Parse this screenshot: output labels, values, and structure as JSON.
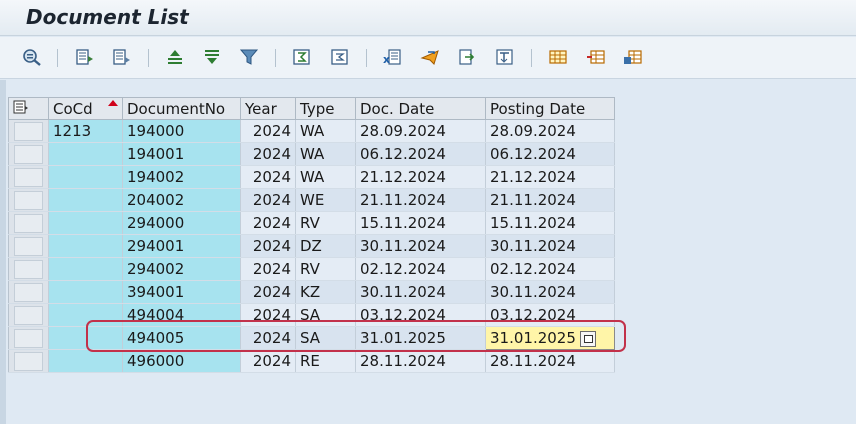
{
  "window": {
    "title": "Document List"
  },
  "toolbar": {
    "icons": [
      "details-icon",
      "choose-layout-icon",
      "select-layout-icon",
      "sort-ascending-icon",
      "sort-descending-icon",
      "filter-icon",
      "total-icon",
      "subtotal-icon",
      "export-spreadsheet-icon",
      "send-icon",
      "print-preview-icon",
      "abc-analysis-icon",
      "change-layout-icon",
      "select-columns-icon",
      "save-layout-icon"
    ]
  },
  "table": {
    "headers": {
      "cocd": "CoCd",
      "docno": "DocumentNo",
      "year": "Year",
      "type": "Type",
      "docdate": "Doc. Date",
      "postdate": "Posting Date"
    },
    "cocd_value": "1213",
    "rows": [
      {
        "docno": "194000",
        "year": "2024",
        "type": "WA",
        "docdate": "28.09.2024",
        "postdate": "28.09.2024"
      },
      {
        "docno": "194001",
        "year": "2024",
        "type": "WA",
        "docdate": "06.12.2024",
        "postdate": "06.12.2024"
      },
      {
        "docno": "194002",
        "year": "2024",
        "type": "WA",
        "docdate": "21.12.2024",
        "postdate": "21.12.2024"
      },
      {
        "docno": "204002",
        "year": "2024",
        "type": "WE",
        "docdate": "21.11.2024",
        "postdate": "21.11.2024"
      },
      {
        "docno": "294000",
        "year": "2024",
        "type": "RV",
        "docdate": "15.11.2024",
        "postdate": "15.11.2024"
      },
      {
        "docno": "294001",
        "year": "2024",
        "type": "DZ",
        "docdate": "30.11.2024",
        "postdate": "30.11.2024"
      },
      {
        "docno": "294002",
        "year": "2024",
        "type": "RV",
        "docdate": "02.12.2024",
        "postdate": "02.12.2024"
      },
      {
        "docno": "394001",
        "year": "2024",
        "type": "KZ",
        "docdate": "30.11.2024",
        "postdate": "30.11.2024"
      },
      {
        "docno": "494004",
        "year": "2024",
        "type": "SA",
        "docdate": "03.12.2024",
        "postdate": "03.12.2024"
      },
      {
        "docno": "494005",
        "year": "2024",
        "type": "SA",
        "docdate": "31.01.2025",
        "postdate": "31.01.2025"
      },
      {
        "docno": "496000",
        "year": "2024",
        "type": "RE",
        "docdate": "28.11.2024",
        "postdate": "28.11.2024"
      }
    ],
    "highlighted_row": 9
  },
  "colors": {
    "key_column": "#a7e3ef",
    "highlight_cell": "#fff5a8",
    "annotation_box": "#c2314a",
    "sort_marker": "#d0021b"
  }
}
